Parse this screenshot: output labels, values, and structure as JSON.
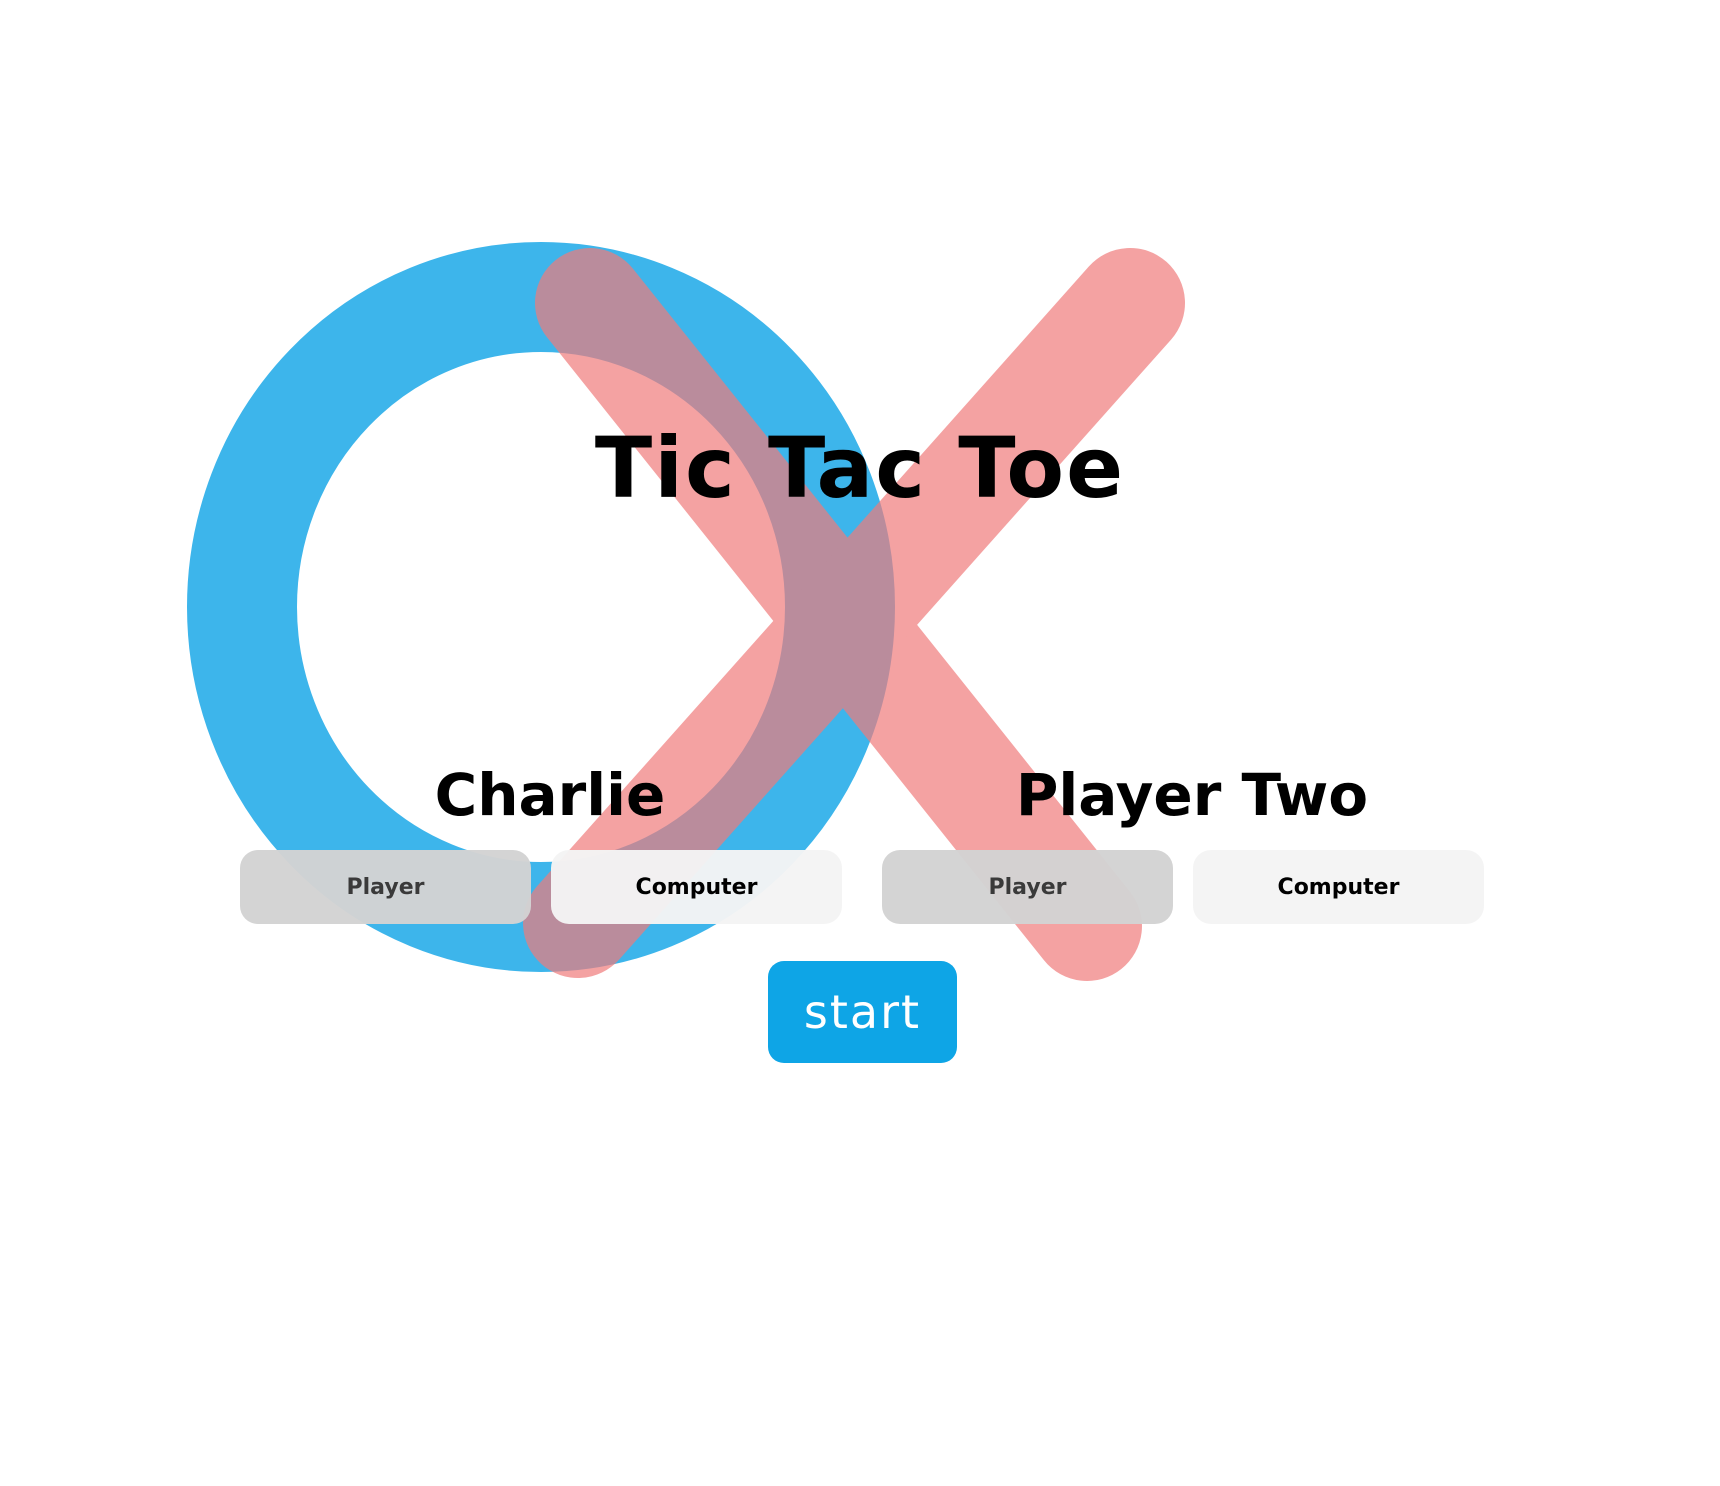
{
  "app": {
    "title": "Tic Tac Toe"
  },
  "colors": {
    "o_mark": "#3db5eb",
    "x_mark": "#f07b7b",
    "start_button": "#0ea5e6",
    "selected_toggle": "#d3d3d3",
    "unselected_toggle": "#f4f4f4"
  },
  "players": [
    {
      "name": "Charlie",
      "options": [
        "Player",
        "Computer"
      ],
      "selected": "Player"
    },
    {
      "name": "Player Two",
      "options": [
        "Player",
        "Computer"
      ],
      "selected": "Player"
    }
  ],
  "start_label": "start"
}
